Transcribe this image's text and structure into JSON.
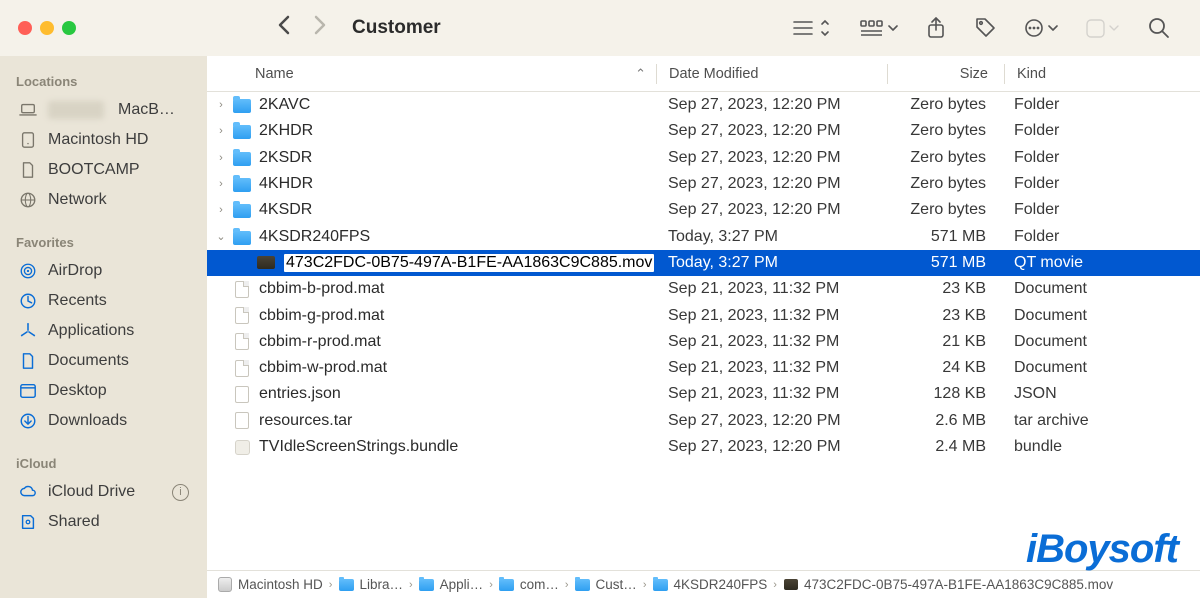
{
  "window_title": "Customer",
  "sidebar": {
    "sections": [
      {
        "header": "Locations",
        "items": [
          {
            "label": "MacB…",
            "icon": "laptop",
            "blurred": true
          },
          {
            "label": "Macintosh HD",
            "icon": "hd"
          },
          {
            "label": "BOOTCAMP",
            "icon": "doc"
          },
          {
            "label": "Network",
            "icon": "globe"
          }
        ]
      },
      {
        "header": "Favorites",
        "items": [
          {
            "label": "AirDrop",
            "icon": "airdrop"
          },
          {
            "label": "Recents",
            "icon": "clock"
          },
          {
            "label": "Applications",
            "icon": "apps"
          },
          {
            "label": "Documents",
            "icon": "docfile"
          },
          {
            "label": "Desktop",
            "icon": "desktop"
          },
          {
            "label": "Downloads",
            "icon": "download"
          }
        ]
      },
      {
        "header": "iCloud",
        "items": [
          {
            "label": "iCloud Drive",
            "icon": "cloud",
            "info": true
          },
          {
            "label": "Shared",
            "icon": "shared"
          }
        ]
      }
    ]
  },
  "columns": {
    "name": "Name",
    "date": "Date Modified",
    "size": "Size",
    "kind": "Kind"
  },
  "rows": [
    {
      "depth": 0,
      "disclosure": "right",
      "icon": "folder",
      "name": "2KAVC",
      "date": "Sep 27, 2023, 12:20 PM",
      "size": "Zero bytes",
      "kind": "Folder"
    },
    {
      "depth": 0,
      "disclosure": "right",
      "icon": "folder",
      "name": "2KHDR",
      "date": "Sep 27, 2023, 12:20 PM",
      "size": "Zero bytes",
      "kind": "Folder"
    },
    {
      "depth": 0,
      "disclosure": "right",
      "icon": "folder",
      "name": "2KSDR",
      "date": "Sep 27, 2023, 12:20 PM",
      "size": "Zero bytes",
      "kind": "Folder"
    },
    {
      "depth": 0,
      "disclosure": "right",
      "icon": "folder",
      "name": "4KHDR",
      "date": "Sep 27, 2023, 12:20 PM",
      "size": "Zero bytes",
      "kind": "Folder"
    },
    {
      "depth": 0,
      "disclosure": "right",
      "icon": "folder",
      "name": "4KSDR",
      "date": "Sep 27, 2023, 12:20 PM",
      "size": "Zero bytes",
      "kind": "Folder"
    },
    {
      "depth": 0,
      "disclosure": "down",
      "icon": "folder",
      "name": "4KSDR240FPS",
      "date": "Today, 3:27 PM",
      "size": "571 MB",
      "kind": "Folder"
    },
    {
      "depth": 1,
      "disclosure": "",
      "icon": "mov",
      "name": "473C2FDC-0B75-497A-B1FE-AA1863C9C885.mov",
      "date": "Today, 3:27 PM",
      "size": "571 MB",
      "kind": "QT movie",
      "selected": true,
      "rename": true
    },
    {
      "depth": 0,
      "disclosure": "",
      "icon": "doc",
      "name": "cbbim-b-prod.mat",
      "date": "Sep 21, 2023, 11:32 PM",
      "size": "23 KB",
      "kind": "Document"
    },
    {
      "depth": 0,
      "disclosure": "",
      "icon": "doc",
      "name": "cbbim-g-prod.mat",
      "date": "Sep 21, 2023, 11:32 PM",
      "size": "23 KB",
      "kind": "Document"
    },
    {
      "depth": 0,
      "disclosure": "",
      "icon": "doc",
      "name": "cbbim-r-prod.mat",
      "date": "Sep 21, 2023, 11:32 PM",
      "size": "21 KB",
      "kind": "Document"
    },
    {
      "depth": 0,
      "disclosure": "",
      "icon": "doc",
      "name": "cbbim-w-prod.mat",
      "date": "Sep 21, 2023, 11:32 PM",
      "size": "24 KB",
      "kind": "Document"
    },
    {
      "depth": 0,
      "disclosure": "",
      "icon": "json",
      "name": "entries.json",
      "date": "Sep 21, 2023, 11:32 PM",
      "size": "128 KB",
      "kind": "JSON"
    },
    {
      "depth": 0,
      "disclosure": "",
      "icon": "tar",
      "name": "resources.tar",
      "date": "Sep 27, 2023, 12:20 PM",
      "size": "2.6 MB",
      "kind": "tar archive"
    },
    {
      "depth": 0,
      "disclosure": "",
      "icon": "bundle",
      "name": "TVIdleScreenStrings.bundle",
      "date": "Sep 27, 2023, 12:20 PM",
      "size": "2.4 MB",
      "kind": "bundle"
    }
  ],
  "path": [
    {
      "icon": "hd",
      "label": "Macintosh HD"
    },
    {
      "icon": "folder",
      "label": "Libra…"
    },
    {
      "icon": "folder",
      "label": "Appli…"
    },
    {
      "icon": "folder",
      "label": "com…"
    },
    {
      "icon": "folder",
      "label": "Cust…"
    },
    {
      "icon": "folder",
      "label": "4KSDR240FPS"
    },
    {
      "icon": "mov",
      "label": "473C2FDC-0B75-497A-B1FE-AA1863C9C885.mov"
    }
  ],
  "watermark": "iBoysoft"
}
